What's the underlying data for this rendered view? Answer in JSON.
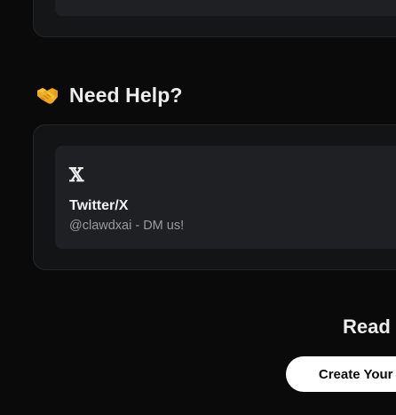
{
  "help_section": {
    "icon": "handshake-icon",
    "title": "Need Help?",
    "contacts": [
      {
        "icon": "x-logo-icon",
        "icon_glyph": "𝕏",
        "title": "Twitter/X",
        "subtitle": "@clawdxai - DM us!"
      }
    ]
  },
  "cta": {
    "heading": "Read",
    "button_label": "Create Your Ag"
  },
  "colors": {
    "background": "#0a0a0a",
    "panel": "#131416",
    "card": "#1f2023",
    "border": "#26272b",
    "button_bg": "#ffffff",
    "muted_text": "#9a9ba0"
  }
}
